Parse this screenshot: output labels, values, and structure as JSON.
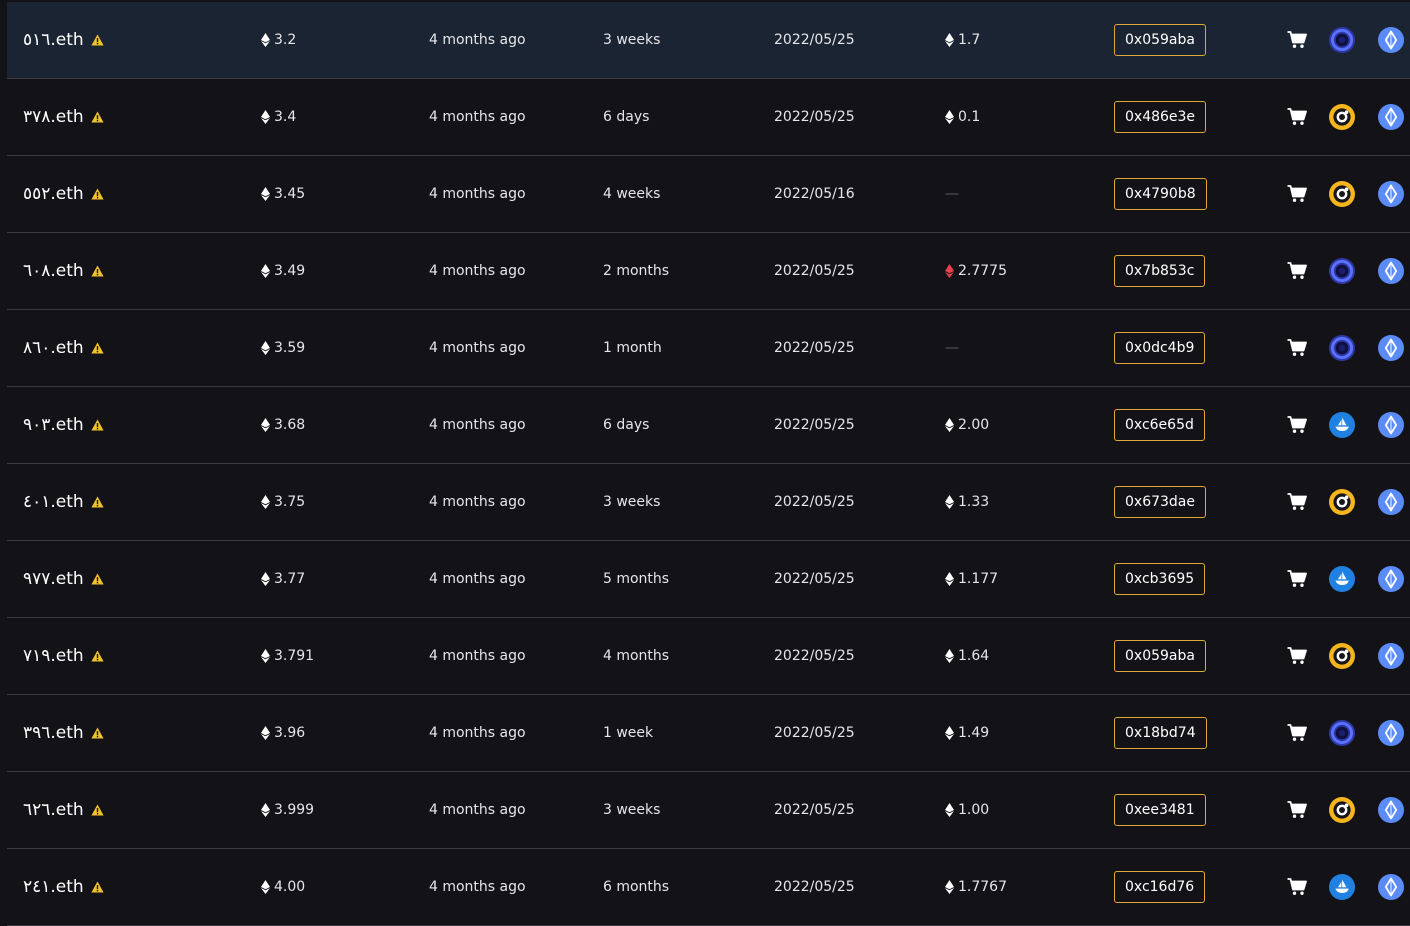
{
  "colors": {
    "background": "#131317",
    "highlight_row": "#1b2432",
    "owner_border": "#e0a83a",
    "warning": "#f2c12e",
    "eth_red": "#e8414e"
  },
  "rows": [
    {
      "name": "٥١٦.eth",
      "price": "3.2",
      "listed": "4 months ago",
      "age": "3 weeks",
      "date": "2022/05/25",
      "last_sale": "1.7",
      "last_sale_variant": "white",
      "owner": "0x059aba",
      "marketplace": "looksrare",
      "highlight": true
    },
    {
      "name": "٣٧٨.eth",
      "price": "3.4",
      "listed": "4 months ago",
      "age": "6 days",
      "date": "2022/05/25",
      "last_sale": "0.1",
      "last_sale_variant": "white",
      "owner": "0x486e3e",
      "marketplace": "x2y2"
    },
    {
      "name": "٥٥٢.eth",
      "price": "3.45",
      "listed": "4 months ago",
      "age": "4 weeks",
      "date": "2022/05/16",
      "last_sale": "—",
      "last_sale_variant": "none",
      "owner": "0x4790b8",
      "marketplace": "x2y2"
    },
    {
      "name": "٦٠٨.eth",
      "price": "3.49",
      "listed": "4 months ago",
      "age": "2 months",
      "date": "2022/05/25",
      "last_sale": "2.7775",
      "last_sale_variant": "red",
      "owner": "0x7b853c",
      "marketplace": "looksrare"
    },
    {
      "name": "٨٦٠.eth",
      "price": "3.59",
      "listed": "4 months ago",
      "age": "1 month",
      "date": "2022/05/25",
      "last_sale": "—",
      "last_sale_variant": "none",
      "owner": "0x0dc4b9",
      "marketplace": "looksrare"
    },
    {
      "name": "٩٠٣.eth",
      "price": "3.68",
      "listed": "4 months ago",
      "age": "6 days",
      "date": "2022/05/25",
      "last_sale": "2.00",
      "last_sale_variant": "white",
      "owner": "0xc6e65d",
      "marketplace": "opensea"
    },
    {
      "name": "٤٠١.eth",
      "price": "3.75",
      "listed": "4 months ago",
      "age": "3 weeks",
      "date": "2022/05/25",
      "last_sale": "1.33",
      "last_sale_variant": "white",
      "owner": "0x673dae",
      "marketplace": "x2y2"
    },
    {
      "name": "٩٧٧.eth",
      "price": "3.77",
      "listed": "4 months ago",
      "age": "5 months",
      "date": "2022/05/25",
      "last_sale": "1.177",
      "last_sale_variant": "white",
      "owner": "0xcb3695",
      "marketplace": "opensea"
    },
    {
      "name": "٧١٩.eth",
      "price": "3.791",
      "listed": "4 months ago",
      "age": "4 months",
      "date": "2022/05/25",
      "last_sale": "1.64",
      "last_sale_variant": "white",
      "owner": "0x059aba",
      "marketplace": "x2y2"
    },
    {
      "name": "٣٩٦.eth",
      "price": "3.96",
      "listed": "4 months ago",
      "age": "1 week",
      "date": "2022/05/25",
      "last_sale": "1.49",
      "last_sale_variant": "white",
      "owner": "0x18bd74",
      "marketplace": "looksrare"
    },
    {
      "name": "٦٢٦.eth",
      "price": "3.999",
      "listed": "4 months ago",
      "age": "3 weeks",
      "date": "2022/05/25",
      "last_sale": "1.00",
      "last_sale_variant": "white",
      "owner": "0xee3481",
      "marketplace": "x2y2"
    },
    {
      "name": "٢٤١.eth",
      "price": "4.00",
      "listed": "4 months ago",
      "age": "6 months",
      "date": "2022/05/25",
      "last_sale": "1.7767",
      "last_sale_variant": "white",
      "owner": "0xc16d76",
      "marketplace": "opensea"
    }
  ]
}
